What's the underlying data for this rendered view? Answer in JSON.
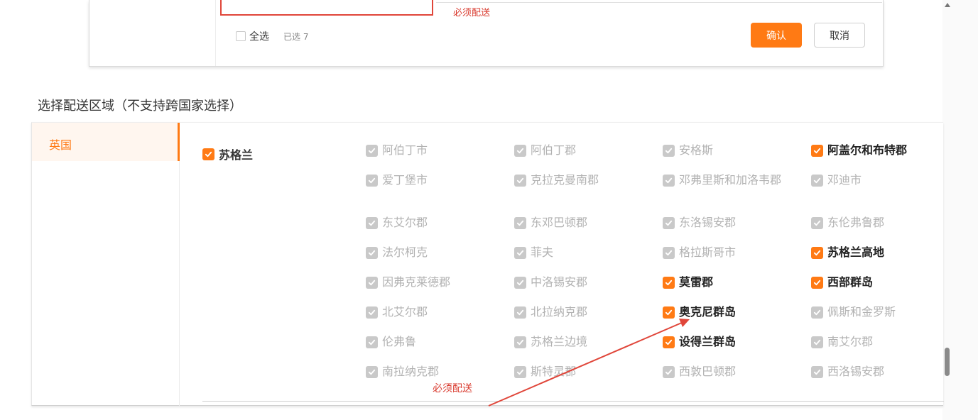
{
  "top_dialog": {
    "required_note": "必须配送",
    "select_all_label": "全选",
    "selected_count": "已选 7",
    "confirm_label": "确认",
    "cancel_label": "取消"
  },
  "region_panel": {
    "title": "选择配送区域（不支持跨国家选择）",
    "country": "英国",
    "group_label": "苏格兰",
    "group_checked": true,
    "regions": [
      [
        "阿伯丁市",
        "阿伯丁郡",
        "安格斯",
        "阿盖尔和布特郡"
      ],
      [
        "爱丁堡市",
        "克拉克曼南郡",
        "邓弗里斯和加洛韦郡",
        "邓迪市"
      ],
      [
        "东艾尔郡",
        "东邓巴顿郡",
        "东洛锡安郡",
        "东伦弗鲁郡"
      ],
      [
        "法尔柯克",
        "菲夫",
        "格拉斯哥市",
        "苏格兰高地"
      ],
      [
        "因弗克莱德郡",
        "中洛锡安郡",
        "莫雷郡",
        "西部群岛"
      ],
      [
        "北艾尔郡",
        "北拉纳克郡",
        "奥克尼群岛",
        "佩斯和金罗斯"
      ],
      [
        "伦弗鲁",
        "苏格兰边境",
        "设得兰群岛",
        "南艾尔郡"
      ],
      [
        "南拉纳克郡",
        "斯特灵郡",
        "西敦巴顿郡",
        "西洛锡安郡"
      ]
    ],
    "checked_regions": [
      "阿盖尔和布特郡",
      "苏格兰高地",
      "莫雷郡",
      "西部群岛",
      "奥克尼群岛",
      "设得兰群岛"
    ],
    "required_note": "必须配送"
  },
  "colors": {
    "accent": "#ff7a14",
    "annotation": "#e0463a",
    "disabled_check": "#c9c9c9"
  }
}
